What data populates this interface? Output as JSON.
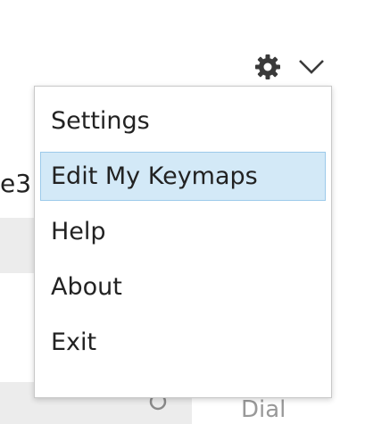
{
  "background": {
    "partial_text": "e3",
    "bottom_label": "Dial"
  },
  "header": {
    "gear_icon": "gear-icon",
    "chevron_icon": "chevron-down-icon"
  },
  "menu": {
    "items": [
      {
        "label": "Settings",
        "highlighted": false
      },
      {
        "label": "Edit My Keymaps",
        "highlighted": true
      },
      {
        "label": "Help",
        "highlighted": false
      },
      {
        "label": "About",
        "highlighted": false
      },
      {
        "label": "Exit",
        "highlighted": false
      }
    ]
  },
  "colors": {
    "highlight_fill": "#d3e9f7",
    "highlight_border": "#9ccaea",
    "icon": "#3a3a3a",
    "menu_border": "#c8c8c8"
  }
}
